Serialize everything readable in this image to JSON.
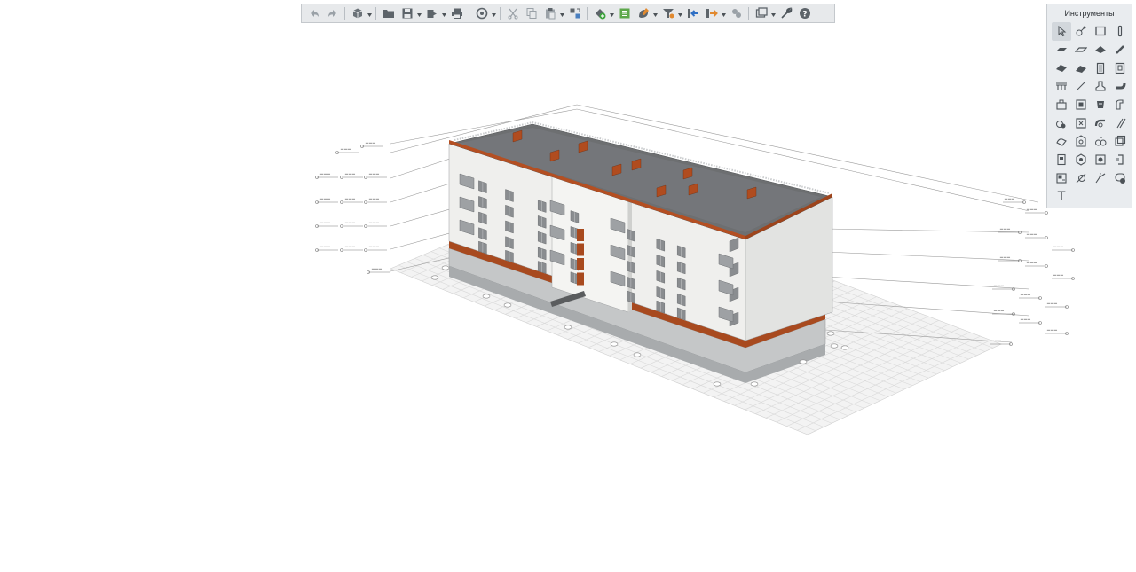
{
  "toolbar": {
    "buttons": [
      {
        "name": "undo-button",
        "icon": "undo-icon"
      },
      {
        "name": "redo-button",
        "icon": "redo-icon"
      },
      {
        "sep": true
      },
      {
        "name": "views-button",
        "icon": "cube-icon",
        "dropdown": true
      },
      {
        "sep": true
      },
      {
        "name": "open-button",
        "icon": "folder-icon"
      },
      {
        "name": "save-button",
        "icon": "floppy-icon",
        "dropdown": true
      },
      {
        "name": "export-button",
        "icon": "export-icon",
        "dropdown": true
      },
      {
        "name": "print-button",
        "icon": "printer-icon"
      },
      {
        "sep": true
      },
      {
        "name": "sync-button",
        "icon": "sync-icon",
        "dropdown": true
      },
      {
        "sep": true
      },
      {
        "name": "cut-button",
        "icon": "scissors-icon"
      },
      {
        "name": "copy-button",
        "icon": "copy-icon"
      },
      {
        "name": "paste-button",
        "icon": "clipboard-icon",
        "dropdown": true
      },
      {
        "name": "transfer-button",
        "icon": "transfer-icon"
      },
      {
        "sep": true
      },
      {
        "name": "add-button",
        "icon": "add-icon",
        "dropdown": true
      },
      {
        "name": "list-button",
        "icon": "list-icon"
      },
      {
        "name": "edit-button",
        "icon": "pencil-icon",
        "dropdown": true
      },
      {
        "name": "filter-button",
        "icon": "filter-icon",
        "dropdown": true
      },
      {
        "name": "import-button",
        "icon": "import-icon"
      },
      {
        "name": "export-out-button",
        "icon": "export-out-icon",
        "dropdown": true
      },
      {
        "name": "render-button",
        "icon": "render-icon"
      },
      {
        "sep": true
      },
      {
        "name": "display-button",
        "icon": "windows-icon",
        "dropdown": true
      },
      {
        "name": "settings-button",
        "icon": "wrench-icon"
      },
      {
        "name": "help-button",
        "icon": "help-icon"
      }
    ]
  },
  "tools_panel": {
    "title": "Инструменты",
    "tools": [
      {
        "name": "select-tool",
        "icon": "cursor-icon",
        "active": true
      },
      {
        "name": "axis-tool",
        "icon": "axis-icon"
      },
      {
        "name": "wall-tool",
        "icon": "wall-icon"
      },
      {
        "name": "column-tool",
        "icon": "column-icon"
      },
      {
        "name": "slab-tool",
        "icon": "slab-icon"
      },
      {
        "name": "opening-tool",
        "icon": "opening-icon"
      },
      {
        "name": "roof-tool",
        "icon": "roof-icon"
      },
      {
        "name": "beam-tool",
        "icon": "beam-icon"
      },
      {
        "name": "stair-tool",
        "icon": "stair-icon"
      },
      {
        "name": "ramp-tool",
        "icon": "ramp-icon"
      },
      {
        "name": "door-tool",
        "icon": "door-icon"
      },
      {
        "name": "window-tool",
        "icon": "window-icon"
      },
      {
        "name": "railing-tool",
        "icon": "railing-icon"
      },
      {
        "name": "line-tool",
        "icon": "line-icon"
      },
      {
        "name": "fixture-tool",
        "icon": "fixture-icon"
      },
      {
        "name": "pipe-tool",
        "icon": "pipe-icon"
      },
      {
        "name": "equipment-tool",
        "icon": "equipment-icon"
      },
      {
        "name": "panel-tool",
        "icon": "panel-icon"
      },
      {
        "name": "vent-tool",
        "icon": "vent-icon"
      },
      {
        "name": "duct-tool",
        "icon": "duct-icon"
      },
      {
        "name": "valve-tool",
        "icon": "valve-icon"
      },
      {
        "name": "cabinet-tool",
        "icon": "cabinet-icon"
      },
      {
        "name": "fitting-tool",
        "icon": "fitting-icon"
      },
      {
        "name": "flow-tool",
        "icon": "flow-icon"
      },
      {
        "name": "pump-tool",
        "icon": "pump-icon"
      },
      {
        "name": "shield-tool",
        "icon": "shield-icon"
      },
      {
        "name": "fan-tool",
        "icon": "fan-icon"
      },
      {
        "name": "box-tool",
        "icon": "box-icon"
      },
      {
        "name": "device-tool",
        "icon": "device-icon"
      },
      {
        "name": "light-tool",
        "icon": "light-icon"
      },
      {
        "name": "sensor-tool",
        "icon": "sensor-icon"
      },
      {
        "name": "socket-tool",
        "icon": "socket-icon"
      },
      {
        "name": "tag-tool",
        "icon": "tag-icon"
      },
      {
        "name": "measure-tool",
        "icon": "measure-icon"
      },
      {
        "name": "leader-tool",
        "icon": "leader-icon"
      },
      {
        "name": "cloud-tool",
        "icon": "cloud-icon"
      },
      {
        "name": "text-tool",
        "icon": "text-icon",
        "glyph": "T"
      }
    ]
  },
  "colors": {
    "roof": "#6d6f71",
    "facade": "#f1f1ef",
    "brick": "#a84a1f",
    "plinth": "#b5b7b8",
    "ground_grid": "#dcdcdc"
  }
}
